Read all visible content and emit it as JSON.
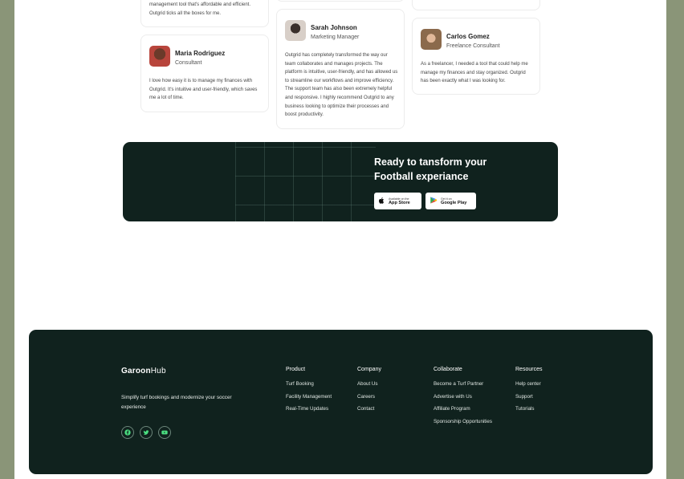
{
  "testimonials": {
    "top_snippet": {
      "line1": "management tool that's affordable and efficient.",
      "line2": "Outgrid ticks all the boxes for me."
    },
    "cards": [
      {
        "name": "Maria Rodriguez",
        "role": "Consultant",
        "quote": "I love how easy it is to manage my finances with Outgrid. It's intuitive and user-friendly, which saves me a lot of time."
      },
      {
        "name": "Sarah Johnson",
        "role": "Marketing Manager",
        "quote": "Outgrid has completely transformed the way our team collaborates and manages projects. The platform is intuitive, user-friendly, and has allowed us to streamline our workflows and improve efficiency. The support team has also been extremely helpful and responsive. I highly recommend Outgrid to any business looking to optimize their processes and boost productivity."
      },
      {
        "name": "Carlos Gomez",
        "role": "Freelance Consultant",
        "quote": "As a freelancer, I needed a tool that could help me manage my finances and stay organized. Outgrid has been exactly what I was looking for."
      }
    ]
  },
  "cta": {
    "headline_line1": "Ready to tansform your",
    "headline_line2": "Football experiance",
    "app_store": {
      "small": "Available on the",
      "big": "App Store"
    },
    "google_play": {
      "small": "Get it on",
      "big": "Google Play"
    }
  },
  "footer": {
    "logo": {
      "main": "Garoon",
      "accent": "Hub"
    },
    "tagline": "Simplify turf bookings and modernize your soccer experience",
    "socials": [
      "facebook-icon",
      "twitter-icon",
      "youtube-icon"
    ],
    "columns": [
      {
        "heading": "Product",
        "links": [
          "Turf Booking",
          "Facility Management",
          "Real-Time Updates"
        ]
      },
      {
        "heading": "Company",
        "links": [
          "About Us",
          "Careers",
          "Contact"
        ]
      },
      {
        "heading": "Collaborate",
        "links": [
          "Become a Turf Partner",
          "Advertise with Us",
          "Affiliate Program",
          "Sponsorship Opportunities"
        ]
      },
      {
        "heading": "Resources",
        "links": [
          "Help center",
          "Support",
          "Tutorials"
        ]
      }
    ]
  },
  "colors": {
    "outer_background": "#8a9578",
    "dark_panel": "#10221e",
    "page": "#ffffff"
  }
}
